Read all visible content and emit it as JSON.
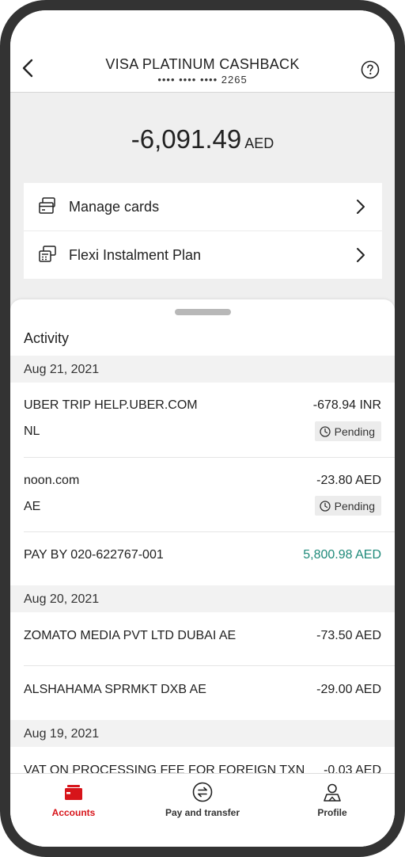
{
  "header": {
    "title": "VISA PLATINUM CASHBACK",
    "masked_number": "•••• •••• •••• 2265",
    "back_icon": "chevron-left-icon",
    "help_icon": "help-circle-icon"
  },
  "summary": {
    "amount": "-6,091.49",
    "currency": "AED"
  },
  "menu": [
    {
      "label": "Manage cards",
      "icon": "cards-icon"
    },
    {
      "label": "Flexi Instalment Plan",
      "icon": "instalment-icon"
    }
  ],
  "activity": {
    "title": "Activity",
    "groups": [
      {
        "date": "Aug 21, 2021",
        "transactions": [
          {
            "name": "UBER TRIP HELP.UBER.COM",
            "amount": "-678.94 INR",
            "sub": "NL",
            "status": "Pending"
          },
          {
            "name": "noon.com",
            "amount": "-23.80 AED",
            "sub": "AE",
            "status": "Pending"
          },
          {
            "name": "PAY BY 020-622767-001",
            "amount": "5,800.98 AED"
          }
        ]
      },
      {
        "date": "Aug 20, 2021",
        "transactions": [
          {
            "name": "ZOMATO MEDIA PVT LTD DUBAI AE",
            "amount": "-73.50 AED"
          },
          {
            "name": "ALSHAHAMA SPRMKT DXB AE",
            "amount": "-29.00 AED"
          }
        ]
      },
      {
        "date": "Aug 19, 2021",
        "transactions": [
          {
            "name": "VAT ON PROCESSING FEE FOR FOREIGN TXN",
            "amount": "-0.03 AED"
          }
        ]
      }
    ]
  },
  "tabs": [
    {
      "label": "Accounts",
      "icon": "wallet-icon",
      "active": true
    },
    {
      "label": "Pay and transfer",
      "icon": "transfer-icon",
      "active": false
    },
    {
      "label": "Profile",
      "icon": "profile-icon",
      "active": false
    }
  ],
  "colors": {
    "accent": "#d7141a",
    "credit": "#1f8a7a"
  }
}
